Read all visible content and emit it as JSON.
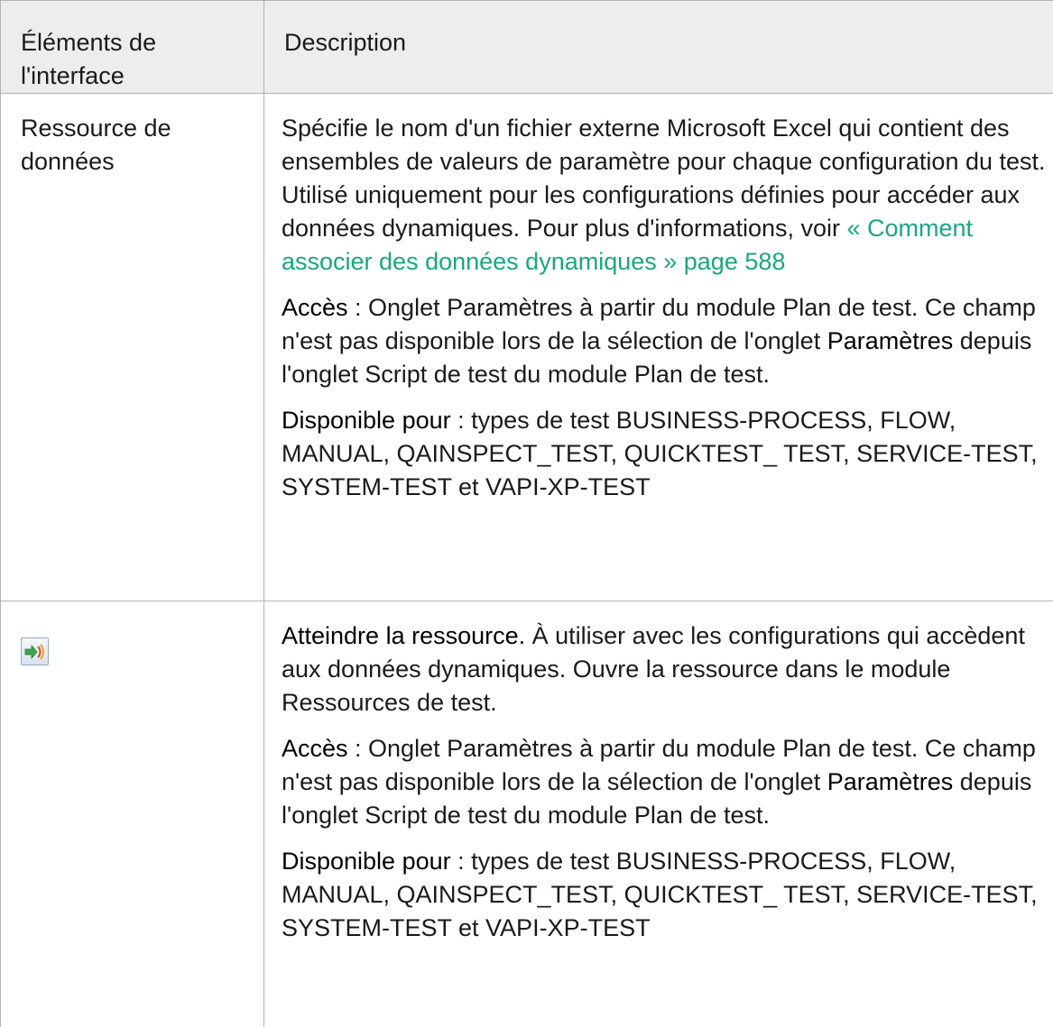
{
  "table": {
    "header": {
      "col1": "Éléments de l'interface",
      "col2": "Description"
    },
    "rows": [
      {
        "element": "Ressource de données",
        "description": {
          "intro": "Spécifie le nom d'un fichier externe Microsoft Excel qui contient des ensembles de valeurs de paramètre pour chaque configuration du test. Utilisé uniquement pour les configurations définies pour accéder aux données dynamiques. Pour plus d'informations, voir ",
          "link": "« Comment associer des données dynamiques » page 588",
          "access_label": "Accès",
          "access_text_1": " : Onglet Paramètres à partir du module Plan de test. Ce champ n'est pas disponible lors de la sélection de l'onglet ",
          "access_strong": "Paramètres",
          "access_text_2": " depuis l'onglet Script de test du module Plan de test.",
          "available_label": "Disponible pour",
          "available_text": " : types de test BUSINESS-PROCESS, FLOW, MANUAL, QAINSPECT_TEST, QUICKTEST_ TEST, SERVICE-TEST, SYSTEM-TEST et VAPI-XP-TEST"
        }
      },
      {
        "element_icon": "go-to-resource-icon",
        "description": {
          "title": "Atteindre la ressource.",
          "intro": " À utiliser avec les configurations qui accèdent aux données dynamiques. Ouvre la ressource dans le module Ressources de test.",
          "access_label": "Accès",
          "access_text_1": " : Onglet Paramètres à partir du module Plan de test. Ce champ n'est pas disponible lors de la sélection de l'onglet ",
          "access_strong": "Paramètres",
          "access_text_2": " depuis l'onglet Script de test du module Plan de test.",
          "available_label": "Disponible pour",
          "available_text": " : types de test BUSINESS-PROCESS, FLOW, MANUAL, QAINSPECT_TEST, QUICKTEST_ TEST, SERVICE-TEST, SYSTEM-TEST et VAPI-XP-TEST"
        }
      }
    ]
  },
  "colors": {
    "link": "#1aa683",
    "header_bg": "#ededed",
    "border": "#b3b3b3"
  }
}
